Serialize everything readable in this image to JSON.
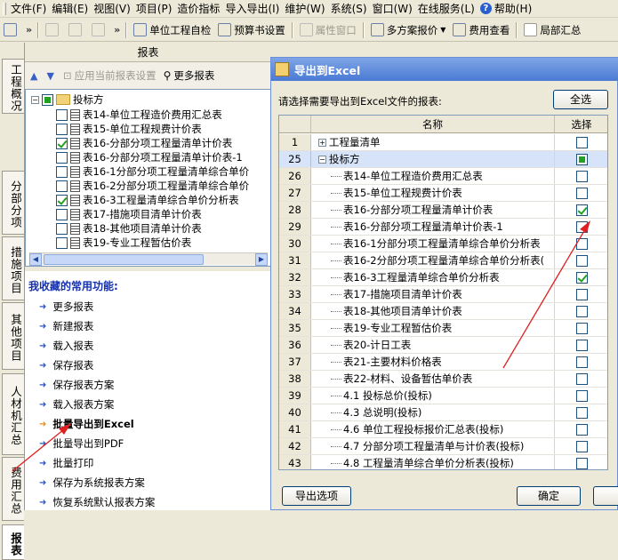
{
  "menubar": {
    "items": [
      "文件(F)",
      "编辑(E)",
      "视图(V)",
      "项目(P)",
      "造价指标",
      "导入导出(I)",
      "维护(W)",
      "系统(S)",
      "窗口(W)",
      "在线服务(L)"
    ],
    "help_label": "帮助(H)"
  },
  "toolbar": {
    "unit_check": "单位工程自检",
    "budget_settings": "预算书设置",
    "property_window": "属性窗口",
    "multi_plan": "多方案报价",
    "fee_view": "费用查看",
    "local_summary": "局部汇总"
  },
  "left_tabs": [
    "工程概况",
    "分部分项",
    "措施项目",
    "其他项目",
    "人材机汇总",
    "费用汇总",
    "报表"
  ],
  "left_panel": {
    "title": "报表",
    "apply_settings": "应用当前报表设置",
    "more_reports": "更多报表",
    "tree_root": "投标方",
    "tree_items": [
      {
        "label": "表14-单位工程造价费用汇总表",
        "checked": false
      },
      {
        "label": "表15-单位工程规费计价表",
        "checked": false
      },
      {
        "label": "表16-分部分项工程量清单计价表",
        "checked": true
      },
      {
        "label": "表16-分部分项工程量清单计价表-1",
        "checked": false
      },
      {
        "label": "表16-1分部分项工程量清单综合单价",
        "checked": false
      },
      {
        "label": "表16-2分部分项工程量清单综合单价",
        "checked": false
      },
      {
        "label": "表16-3工程量清单综合单价分析表",
        "checked": true
      },
      {
        "label": "表17-措施项目清单计价表",
        "checked": false
      },
      {
        "label": "表18-其他项目清单计价表",
        "checked": false
      },
      {
        "label": "表19-专业工程暂估价表",
        "checked": false
      }
    ]
  },
  "favorites": {
    "title": "我收藏的常用功能:",
    "items": [
      "更多报表",
      "新建报表",
      "载入报表",
      "保存报表",
      "保存报表方案",
      "载入报表方案",
      "批量导出到Excel",
      "批量导出到PDF",
      "批量打印",
      "保存为系统报表方案",
      "恢复系统默认报表方案"
    ],
    "highlighted_index": 6
  },
  "dialog": {
    "title": "导出到Excel",
    "prompt": "请选择需要导出到Excel文件的报表:",
    "select_all": "全选",
    "col_name": "名称",
    "col_select": "选择",
    "rows": [
      {
        "no": "1",
        "name": "工程量清单",
        "level": 0,
        "expand": "+",
        "checked": false
      },
      {
        "no": "25",
        "name": "投标方",
        "level": 0,
        "expand": "−",
        "checked": "partial"
      },
      {
        "no": "26",
        "name": "表14-单位工程造价费用汇总表",
        "level": 1,
        "checked": false
      },
      {
        "no": "27",
        "name": "表15-单位工程规费计价表",
        "level": 1,
        "checked": false
      },
      {
        "no": "28",
        "name": "表16-分部分项工程量清单计价表",
        "level": 1,
        "checked": true
      },
      {
        "no": "29",
        "name": "表16-分部分项工程量清单计价表-1",
        "level": 1,
        "checked": false
      },
      {
        "no": "30",
        "name": "表16-1分部分项工程量清单综合单价分析表",
        "level": 1,
        "checked": false
      },
      {
        "no": "31",
        "name": "表16-2分部分项工程量清单综合单价分析表(",
        "level": 1,
        "checked": false
      },
      {
        "no": "32",
        "name": "表16-3工程量清单综合单价分析表",
        "level": 1,
        "checked": true
      },
      {
        "no": "33",
        "name": "表17-措施项目清单计价表",
        "level": 1,
        "checked": false
      },
      {
        "no": "34",
        "name": "表18-其他项目清单计价表",
        "level": 1,
        "checked": false
      },
      {
        "no": "35",
        "name": "表19-专业工程暂估价表",
        "level": 1,
        "checked": false
      },
      {
        "no": "36",
        "name": "表20-计日工表",
        "level": 1,
        "checked": false
      },
      {
        "no": "37",
        "name": "表21-主要材料价格表",
        "level": 1,
        "checked": false
      },
      {
        "no": "38",
        "name": "表22-材料、设备暂估单价表",
        "level": 1,
        "checked": false
      },
      {
        "no": "39",
        "name": "4.1 投标总价(投标)",
        "level": 1,
        "checked": false
      },
      {
        "no": "40",
        "name": "4.3 总说明(投标)",
        "level": 1,
        "checked": false
      },
      {
        "no": "41",
        "name": "4.6 单位工程投标报价汇总表(投标)",
        "level": 1,
        "checked": false
      },
      {
        "no": "42",
        "name": "4.7 分部分项工程量清单与计价表(投标)",
        "level": 1,
        "checked": false
      },
      {
        "no": "43",
        "name": "4.8 工程量清单综合单价分析表(投标)",
        "level": 1,
        "checked": false
      }
    ],
    "export_options": "导出选项",
    "ok": "确定"
  }
}
